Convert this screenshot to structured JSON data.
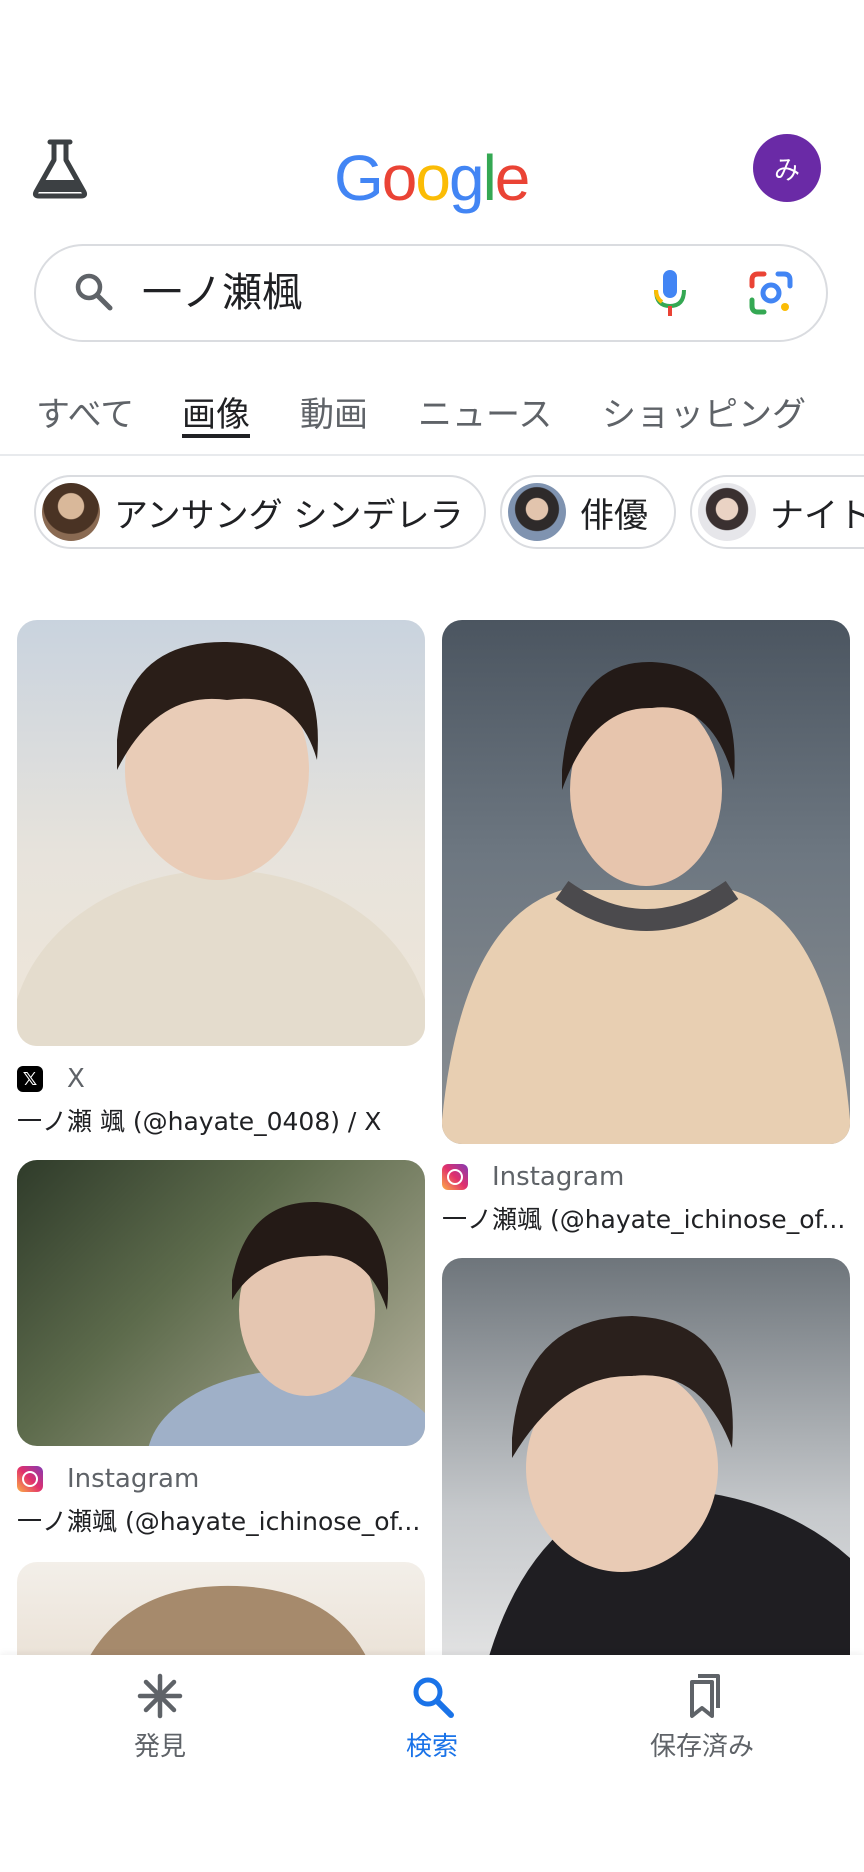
{
  "header": {
    "labs_icon": "flask-icon",
    "logo": [
      "G",
      "o",
      "o",
      "g",
      "l",
      "e"
    ],
    "logo_colors": [
      "#4285f4",
      "#ea4335",
      "#fbbc05",
      "#4285f4",
      "#34a853",
      "#ea4335"
    ],
    "avatar_initial": "み",
    "avatar_color": "#6a2aa6"
  },
  "search": {
    "query": "一ノ瀬楓",
    "search_icon": "search-icon",
    "mic_icon": "mic-icon",
    "lens_icon": "google-lens-icon"
  },
  "tabs": [
    {
      "label": "すべて",
      "active": false
    },
    {
      "label": "画像",
      "active": true
    },
    {
      "label": "動画",
      "active": false
    },
    {
      "label": "ニュース",
      "active": false
    },
    {
      "label": "ショッピング",
      "active": false
    }
  ],
  "chips": [
    {
      "label": "アンサング シンデレラ"
    },
    {
      "label": "俳優"
    },
    {
      "label": "ナイト"
    }
  ],
  "results": [
    {
      "source": "X",
      "source_icon": "x-logo-icon",
      "title": "一ノ瀬 颯 (@hayate_0408) / X"
    },
    {
      "source": "Instagram",
      "source_icon": "instagram-icon",
      "title": "一ノ瀬颯 (@hayate_ichinose_of..."
    },
    {
      "source": "Instagram",
      "source_icon": "instagram-icon",
      "title": "一ノ瀬颯 (@hayate_ichinose_of..."
    }
  ],
  "bottom_nav": [
    {
      "label": "発見",
      "icon": "asterisk-icon",
      "active": false
    },
    {
      "label": "検索",
      "icon": "search-icon",
      "active": true
    },
    {
      "label": "保存済み",
      "icon": "bookmarks-icon",
      "active": false
    }
  ],
  "colors": {
    "accent": "#1a73e8",
    "muted": "#5f6368"
  }
}
